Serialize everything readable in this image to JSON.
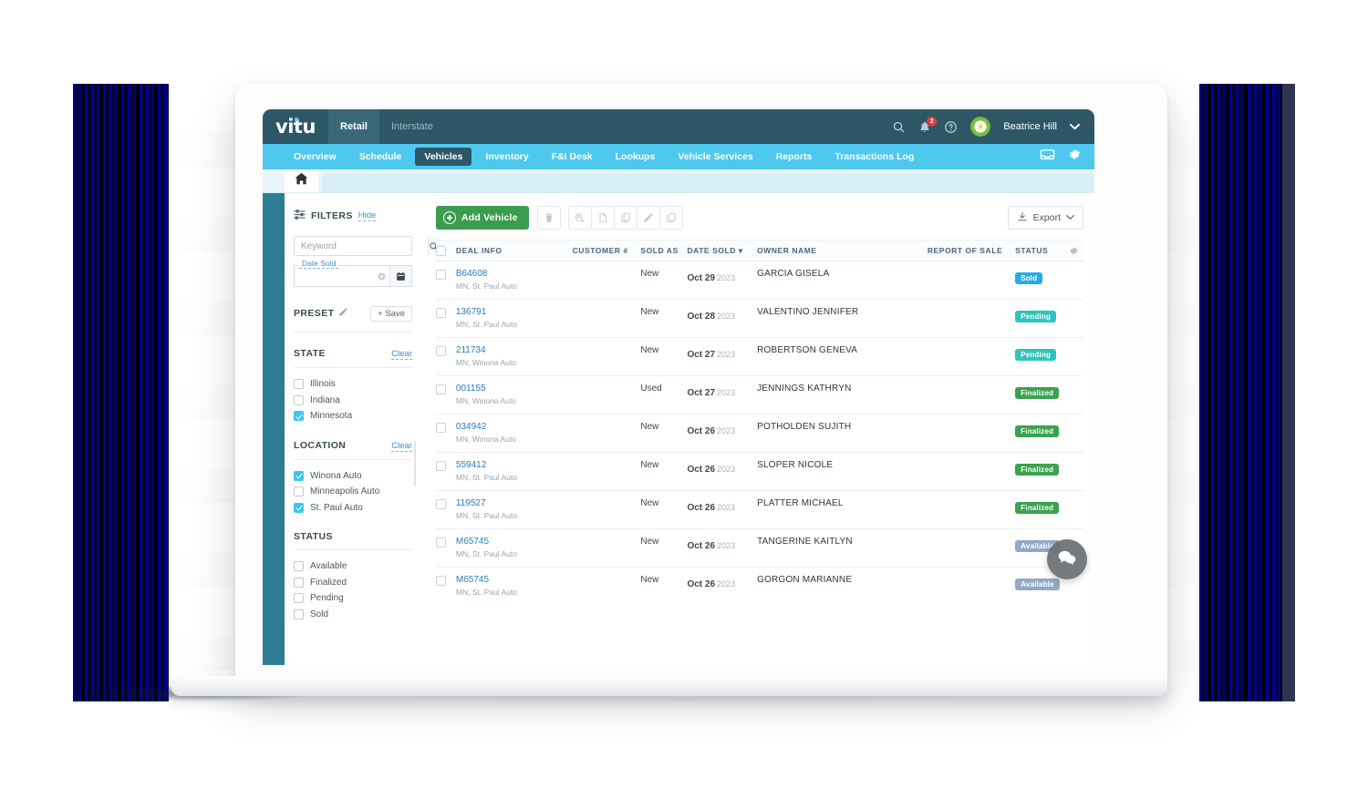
{
  "topbar": {
    "logo": "vitu",
    "tabs": [
      {
        "label": "Retail",
        "active": true
      },
      {
        "label": "Interstate",
        "active": false
      }
    ],
    "icons": [
      "search-icon",
      "bell-icon",
      "help-icon"
    ],
    "notification_count": "2",
    "user_name": "Beatrice Hill",
    "chevron": "chevron-down-icon"
  },
  "nav": {
    "items": [
      {
        "label": "Overview",
        "active": false
      },
      {
        "label": "Schedule",
        "active": false
      },
      {
        "label": "Vehicles",
        "active": true
      },
      {
        "label": "Inventory",
        "active": false
      },
      {
        "label": "F&I Desk",
        "active": false
      },
      {
        "label": "Lookups",
        "active": false
      },
      {
        "label": "Vehicle Services",
        "active": false
      },
      {
        "label": "Reports",
        "active": false
      },
      {
        "label": "Transactions Log",
        "active": false
      }
    ],
    "right_icons": [
      "inbox-icon",
      "gear-icon"
    ]
  },
  "tabstrip": {
    "home_icon": "home-icon"
  },
  "filters": {
    "title": "FILTERS",
    "hide_label": "Hide",
    "keyword_placeholder": "Keyword",
    "keyword_value": "",
    "date_legend": "Date Sold",
    "date_value": "",
    "preset_label": "PRESET",
    "save_label": "+ Save",
    "groups": [
      {
        "title": "STATE",
        "clear_label": "Clear",
        "options": [
          {
            "label": "Illinois",
            "checked": false
          },
          {
            "label": "Indiana",
            "checked": false
          },
          {
            "label": "Minnesota",
            "checked": true
          }
        ]
      },
      {
        "title": "LOCATION",
        "clear_label": "Clear",
        "options": [
          {
            "label": "Winona Auto",
            "checked": true
          },
          {
            "label": "Minneapolis Auto",
            "checked": false
          },
          {
            "label": "St. Paul Auto",
            "checked": true
          }
        ]
      },
      {
        "title": "STATUS",
        "clear_label": "",
        "options": [
          {
            "label": "Available",
            "checked": false
          },
          {
            "label": "Finalized",
            "checked": false
          },
          {
            "label": "Pending",
            "checked": false
          },
          {
            "label": "Sold",
            "checked": false
          }
        ]
      }
    ]
  },
  "toolbar": {
    "add_vehicle_label": "Add Vehicle",
    "actions": [
      "trash-icon",
      "location-pin-add-icon",
      "document-icon",
      "copy-icon",
      "pencil-icon",
      "duplicate-icon"
    ],
    "export_label": "Export",
    "export_chevron": "chevron-down-icon"
  },
  "table": {
    "columns": [
      "DEAL INFO",
      "CUSTOMER #",
      "SOLD AS",
      "DATE SOLD",
      "OWNER NAME",
      "REPORT OF SALE",
      "STATUS"
    ],
    "sort_indicator": "▾",
    "gear_icon": "gear-icon",
    "rows": [
      {
        "deal_id": "B64608",
        "deal_sub": "MN, St. Paul Auto",
        "customer": "",
        "sold_as": "New",
        "date": "Oct 29",
        "year": "2023",
        "owner": "GARCIA GISELA",
        "report_of_sale": "",
        "status": "Sold",
        "status_color": "#29abe2"
      },
      {
        "deal_id": "136791",
        "deal_sub": "MN, St. Paul Auto",
        "customer": "",
        "sold_as": "New",
        "date": "Oct 28",
        "year": "2023",
        "owner": "VALENTINO JENNIFER",
        "report_of_sale": "",
        "status": "Pending",
        "status_color": "#2dc4bd"
      },
      {
        "deal_id": "211734",
        "deal_sub": "MN, Winona Auto",
        "customer": "",
        "sold_as": "New",
        "date": "Oct 27",
        "year": "2023",
        "owner": "ROBERTSON GENEVA",
        "report_of_sale": "",
        "status": "Pending",
        "status_color": "#2dc4bd"
      },
      {
        "deal_id": "001155",
        "deal_sub": "MN, Winona Auto",
        "customer": "",
        "sold_as": "Used",
        "date": "Oct 27",
        "year": "2023",
        "owner": "JENNINGS KATHRYN",
        "report_of_sale": "",
        "status": "Finalized",
        "status_color": "#3ba24f"
      },
      {
        "deal_id": "034942",
        "deal_sub": "MN, Winona Auto",
        "customer": "",
        "sold_as": "New",
        "date": "Oct 26",
        "year": "2023",
        "owner": "POTHOLDEN SUJITH",
        "report_of_sale": "",
        "status": "Finalized",
        "status_color": "#3ba24f"
      },
      {
        "deal_id": "559412",
        "deal_sub": "MN, St. Paul Auto",
        "customer": "",
        "sold_as": "New",
        "date": "Oct 26",
        "year": "2023",
        "owner": "SLOPER NICOLE",
        "report_of_sale": "",
        "status": "Finalized",
        "status_color": "#3ba24f"
      },
      {
        "deal_id": "119527",
        "deal_sub": "MN, St. Paul Auto",
        "customer": "",
        "sold_as": "New",
        "date": "Oct 26",
        "year": "2023",
        "owner": "PLATTER MICHAEL",
        "report_of_sale": "",
        "status": "Finalized",
        "status_color": "#3ba24f"
      },
      {
        "deal_id": "M65745",
        "deal_sub": "MN, St. Paul Auto",
        "customer": "",
        "sold_as": "New",
        "date": "Oct 26",
        "year": "2023",
        "owner": "TANGERINE KAITLYN",
        "report_of_sale": "",
        "status": "Available",
        "status_color": "#92a9c6"
      },
      {
        "deal_id": "M65745",
        "deal_sub": "MN, St. Paul Auto",
        "customer": "",
        "sold_as": "New",
        "date": "Oct 26",
        "year": "2023",
        "owner": "GORGON MARIANNE",
        "report_of_sale": "",
        "status": "Available",
        "status_color": "#92a9c6"
      }
    ]
  },
  "chat": {
    "icon": "chat-bubble-icon"
  },
  "colors": {
    "topbar": "#2d5767",
    "navbar": "#4ec8ef",
    "rail": "#2d7e96",
    "primary_green": "#3a9c4e",
    "link": "#2b7cb8"
  }
}
